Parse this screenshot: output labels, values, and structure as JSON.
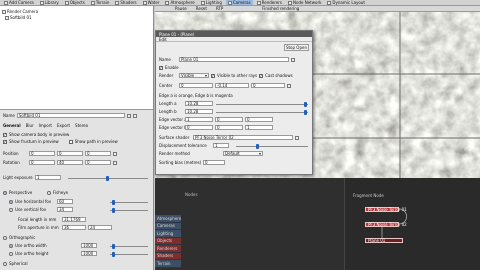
{
  "toolbar": {
    "items": [
      "Add Camera",
      "Library",
      "Objects",
      "Terrain",
      "Shaders",
      "Water",
      "Atmosphere",
      "Lighting",
      "Cameras",
      "Renderers",
      "Node Network",
      "Dynamic Layout"
    ],
    "active_index": 8
  },
  "tree": {
    "items": [
      "Render Camera",
      "Softbild 01"
    ]
  },
  "camera": {
    "name_label": "Name",
    "name_value": "Softbild 01",
    "tabs": [
      "General",
      "Blur",
      "Import",
      "Export",
      "Stereo"
    ],
    "show_camera_body": "Show camera body in preview",
    "show_frustum": "Show frustum in preview",
    "show_path": "Show path in preview",
    "position_label": "Position",
    "position_values": [
      "0",
      "0",
      "0"
    ],
    "rotation_label": "Rotation",
    "rotation_values": [
      "0",
      "40",
      "0"
    ],
    "light_exposure_label": "Light exposure",
    "light_exposure_value": "1",
    "perspective_label": "Perspective",
    "fisheye_label": "Fisheye",
    "use_horizontal_fov": "Use horizontal fov",
    "horizontal_fov": "60",
    "use_vertical_fov": "Use vertical fov",
    "vertical_fov": "34",
    "focal_length_label": "Focal length in mm",
    "focal_length": "31.1769",
    "film_aperture_label": "Film aperture in mm",
    "film_aperture": [
      "36",
      "24"
    ],
    "orthographic_label": "Orthographic",
    "use_ortho_width": "Use ortho width",
    "ortho_width": "1000",
    "use_ortho_height": "Use ortho height",
    "ortho_height": "1000",
    "spherical_label": "Spherical"
  },
  "viewport_bar": {
    "items": [
      "Pause",
      "Reset",
      "RTP",
      "Finished rendering"
    ]
  },
  "dialog": {
    "title": "Plane 01 - (Plane)",
    "menu": "Edit",
    "stop_open": "Stop Open",
    "name_label": "Name",
    "name_value": "Plane 01",
    "enable_label": "Enable",
    "render_label": "Render",
    "render_value": "Visible",
    "visible_other_rays": "Visible to other rays",
    "cast_shadows": "Cast shadows",
    "center_label": "Center",
    "center_values": [
      "0",
      "-0.14",
      "0"
    ],
    "edge_note": "Edge a is orange, Edge b is magenta",
    "length_a_label": "Length a",
    "length_a": "10.28",
    "length_b_label": "Length b",
    "length_b": "10.28",
    "edge_vector_a_label": "Edge vector a",
    "edge_vector_a": [
      "1",
      "0",
      "0"
    ],
    "edge_vector_b_label": "Edge vector b",
    "edge_vector_b": [
      "0",
      "0",
      "1"
    ],
    "surface_shader_label": "Surface shader",
    "surface_shader_value": "PF3 Noise Terror 02",
    "displacement_label": "Displacement tolerance",
    "displacement_value": "1",
    "render_method_label": "Render method",
    "render_method_value": "Default",
    "sorting_bias_label": "Sorting bias (metres)",
    "sorting_bias_value": "0"
  },
  "nodes_panel": {
    "title": "Nodes",
    "items": [
      "Atmosphere",
      "Cameras",
      "Lighting",
      "Objects",
      "Renderers",
      "Shaders",
      "Terrain"
    ]
  },
  "graph": {
    "title": "Fragment Node",
    "nodes": [
      "PF3 Noise Terror 01",
      "PF3 Noise Terror 02",
      "Plane 01"
    ]
  },
  "colors": {
    "accent": "#1f5fbf",
    "node_red": "#b9353a",
    "terrain_base": "#c4c2b8"
  }
}
